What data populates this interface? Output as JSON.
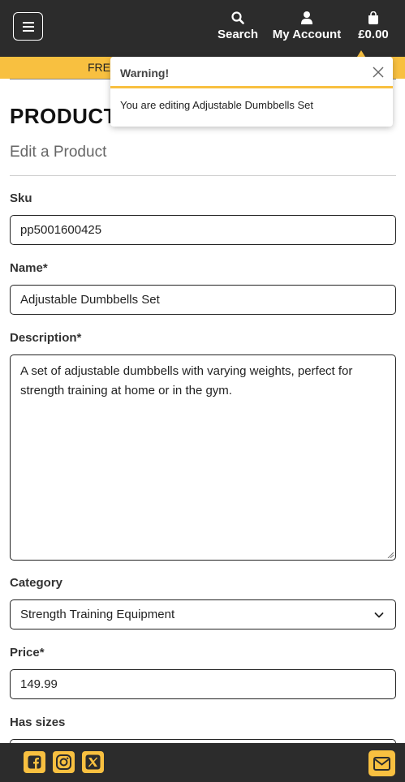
{
  "header": {
    "search_label": "Search",
    "account_label": "My Account",
    "bag_total": "£0.00"
  },
  "promo": {
    "text": "FRE"
  },
  "toast": {
    "title": "Warning!",
    "message": "You are editing Adjustable Dumbbells Set"
  },
  "page": {
    "title": "PRODUCT",
    "subtitle": "Edit a Product"
  },
  "form": {
    "sku": {
      "label": "Sku",
      "value": "pp5001600425"
    },
    "name": {
      "label": "Name*",
      "value": "Adjustable Dumbbells Set"
    },
    "description": {
      "label": "Description*",
      "value": "A set of adjustable dumbbells with varying weights, perfect for strength training at home or in the gym."
    },
    "category": {
      "label": "Category",
      "value": "Strength Training Equipment"
    },
    "price": {
      "label": "Price*",
      "value": "149.99"
    },
    "has_sizes": {
      "label": "Has sizes"
    }
  },
  "colors": {
    "brand_yellow": "#f8c040",
    "header_dark": "#2c2c2c"
  },
  "icons": {
    "menu": "hamburger-icon",
    "search": "search-icon",
    "account": "user-icon",
    "bag": "shopping-bag-icon",
    "close": "close-icon",
    "chevron": "chevron-down-icon",
    "facebook": "facebook-icon",
    "instagram": "instagram-icon",
    "x": "x-twitter-icon",
    "mail": "envelope-icon"
  }
}
